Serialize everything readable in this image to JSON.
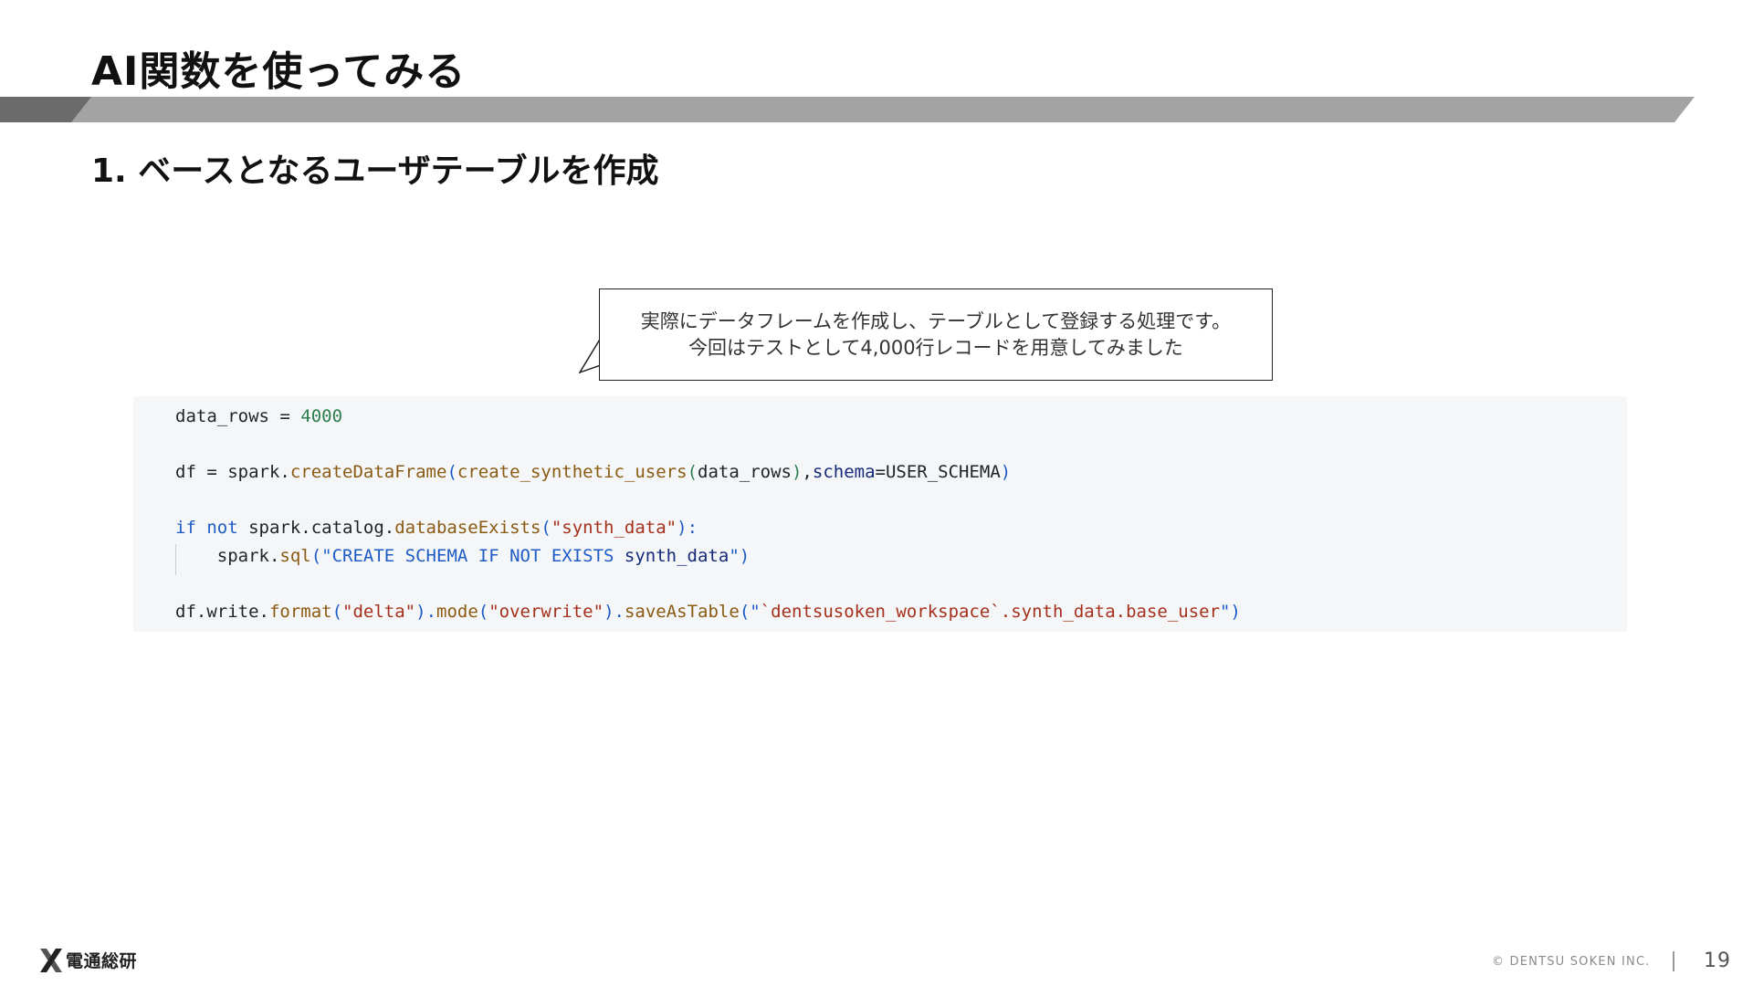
{
  "slide": {
    "title": "AI関数を使ってみる",
    "section_heading": "1. ベースとなるユーザテーブルを作成"
  },
  "callout": {
    "line1": "実際にデータフレームを作成し、テーブルとして登録する処理です。",
    "line2": "今回はテストとして4,000行レコードを用意してみました"
  },
  "code": {
    "lines": [
      [
        {
          "text": "data_rows = ",
          "cls": "default"
        },
        {
          "text": "4000",
          "cls": "number"
        }
      ],
      [
        {
          "text": "df = spark.",
          "cls": "default"
        },
        {
          "text": "createDataFrame",
          "cls": "func"
        },
        {
          "text": "(",
          "cls": "paren"
        },
        {
          "text": "create_synthetic_users",
          "cls": "func"
        },
        {
          "text": "(",
          "cls": "number"
        },
        {
          "text": "data_rows",
          "cls": "default"
        },
        {
          "text": ")",
          "cls": "number"
        },
        {
          "text": ",",
          "cls": "default"
        },
        {
          "text": "schema",
          "cls": "param"
        },
        {
          "text": "=USER_SCHEMA",
          "cls": "default"
        },
        {
          "text": ")",
          "cls": "paren"
        }
      ],
      [
        {
          "text": "if not",
          "cls": "keyword"
        },
        {
          "text": " spark.catalog.",
          "cls": "default"
        },
        {
          "text": "databaseExists",
          "cls": "func"
        },
        {
          "text": "(",
          "cls": "paren"
        },
        {
          "text": "\"synth_data\"",
          "cls": "string"
        },
        {
          "text": "):",
          "cls": "paren"
        }
      ],
      [
        {
          "text": "    spark.",
          "cls": "default"
        },
        {
          "text": "sql",
          "cls": "func"
        },
        {
          "text": "(\"",
          "cls": "paren"
        },
        {
          "text": "CREATE SCHEMA IF NOT EXISTS",
          "cls": "keyword"
        },
        {
          "text": " synth_data",
          "cls": "param"
        },
        {
          "text": "\")",
          "cls": "paren"
        }
      ],
      [
        {
          "text": "df.write.",
          "cls": "default"
        },
        {
          "text": "format",
          "cls": "func"
        },
        {
          "text": "(",
          "cls": "paren"
        },
        {
          "text": "\"delta\"",
          "cls": "string"
        },
        {
          "text": ").",
          "cls": "paren"
        },
        {
          "text": "mode",
          "cls": "func"
        },
        {
          "text": "(",
          "cls": "paren"
        },
        {
          "text": "\"overwrite\"",
          "cls": "string"
        },
        {
          "text": ").",
          "cls": "paren"
        },
        {
          "text": "saveAsTable",
          "cls": "func"
        },
        {
          "text": "(\"",
          "cls": "paren"
        },
        {
          "text": "`dentsusoken_workspace`.synth_data.base_user",
          "cls": "string"
        },
        {
          "text": "\")",
          "cls": "paren"
        }
      ]
    ]
  },
  "footer": {
    "logo_text": "電通総研",
    "copyright": "© DENTSU SOKEN INC.",
    "page_number": "19"
  },
  "colors": {
    "title_bar_dark": "#6b6b6b",
    "title_bar_light": "#a3a3a3",
    "code_background": "#f5f6f8",
    "number": "#2d7d4f",
    "function": "#8a5a12",
    "keyword": "#1d5cc7",
    "string": "#a5301c",
    "parameter": "#152a78"
  }
}
